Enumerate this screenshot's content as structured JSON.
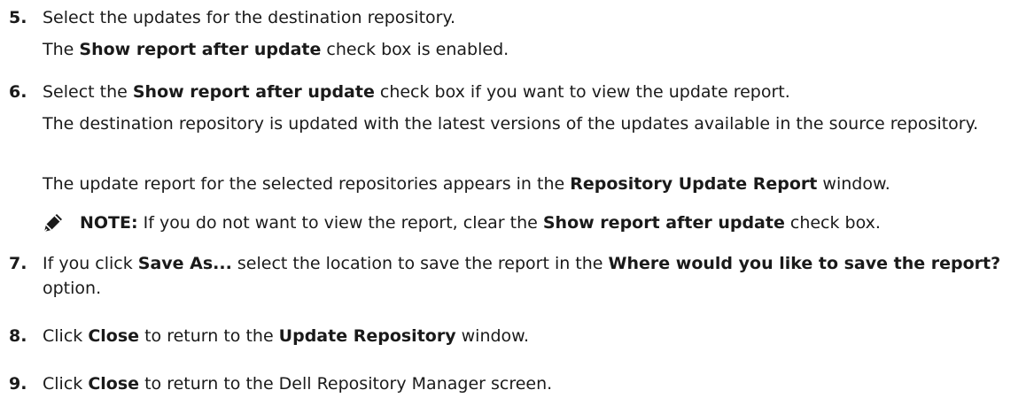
{
  "steps": [
    {
      "number": "5.",
      "lines": [
        [
          {
            "t": "Select the updates for the destination repository."
          }
        ],
        [
          {
            "t": "The "
          },
          {
            "t": "Show report after update",
            "b": true
          },
          {
            "t": " check box is enabled."
          }
        ]
      ]
    },
    {
      "number": "6.",
      "lines": [
        [
          {
            "t": "Select the "
          },
          {
            "t": "Show report after update",
            "b": true
          },
          {
            "t": " check box if you want to view the update report."
          }
        ],
        [
          {
            "t": "The destination repository is updated with the latest versions of the updates available in the source repository."
          }
        ],
        [
          {
            "t": "The update report for the selected repositories appears in the "
          },
          {
            "t": "Repository Update Report",
            "b": true
          },
          {
            "t": " window."
          }
        ]
      ],
      "note": [
        {
          "t": "NOTE:",
          "b": true
        },
        {
          "t": " If you do not want to view the report, clear the "
        },
        {
          "t": "Show report after update",
          "b": true
        },
        {
          "t": " check box."
        }
      ]
    },
    {
      "number": "7.",
      "lines": [
        [
          {
            "t": "If you click "
          },
          {
            "t": "Save As...",
            "b": true
          },
          {
            "t": " select the location to save the report in the "
          },
          {
            "t": "Where would you like to save the report?",
            "b": true
          },
          {
            "t": " option."
          }
        ]
      ]
    },
    {
      "number": "8.",
      "lines": [
        [
          {
            "t": "Click "
          },
          {
            "t": "Close",
            "b": true
          },
          {
            "t": " to return to the "
          },
          {
            "t": "Update Repository",
            "b": true
          },
          {
            "t": " window."
          }
        ]
      ]
    },
    {
      "number": "9.",
      "lines": [
        [
          {
            "t": "Click "
          },
          {
            "t": "Close",
            "b": true
          },
          {
            "t": " to return to the Dell Repository Manager screen."
          }
        ]
      ]
    }
  ],
  "icons": {
    "note": "pencil-note-icon"
  }
}
